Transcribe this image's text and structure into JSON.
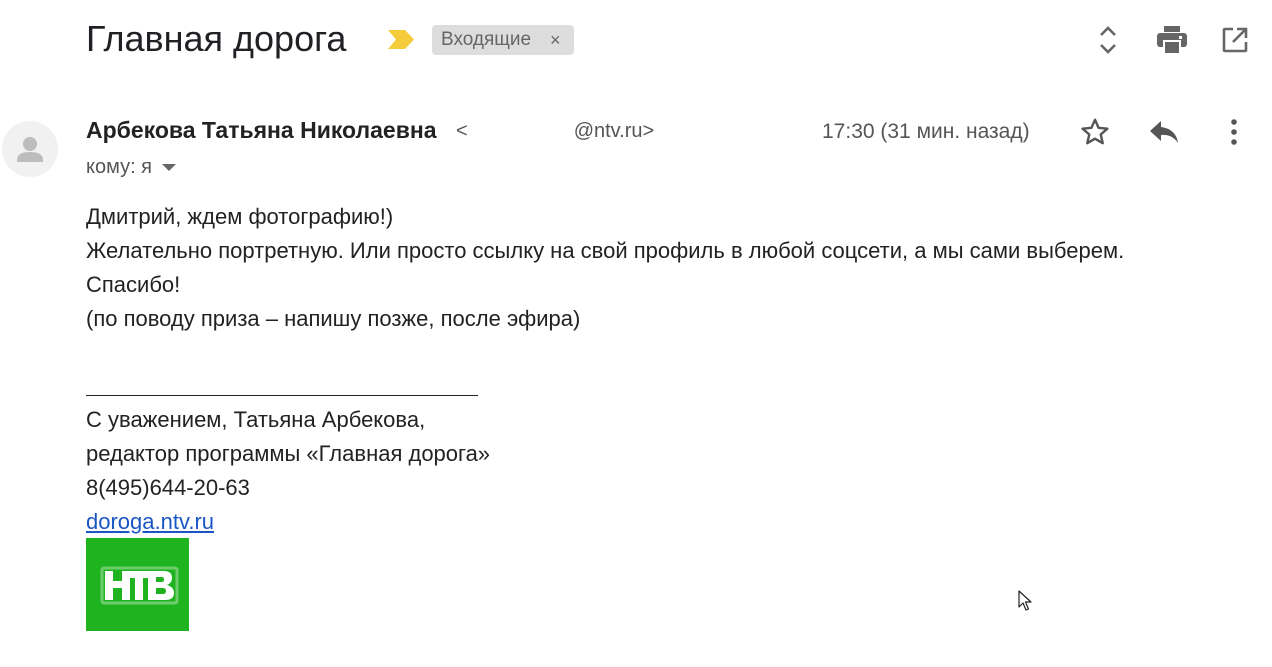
{
  "email": {
    "subject": "Главная дорога",
    "label_chip": "Входящие",
    "label_chip_close": "×",
    "sender_name": "Арбекова Татьяна Николаевна",
    "sender_email_prefix": "<",
    "sender_email_domain": "@ntv.ru>",
    "time": "17:30 (31 мин. назад)",
    "to_label": "кому: я",
    "body_lines": [
      "Дмитрий, ждем фотографию!)",
      "Желательно портретную. Или просто ссылку на свой профиль в любой соцсети, а мы сами выберем.",
      "Спасибо!",
      "(по поводу приза – напишу позже, после эфира)"
    ],
    "signature_lines": [
      "С уважением, Татьяна Арбекова,",
      "редактор программы «Главная дорога»",
      "8(495)644-20-63"
    ],
    "signature_link": "doroga.ntv.ru",
    "logo_text": "НТВ"
  },
  "icons": {
    "top": [
      "expand-collapse-icon",
      "print-icon",
      "open-in-new-window-icon"
    ],
    "header": [
      "star-icon",
      "reply-icon",
      "more-vert-icon"
    ],
    "important_marker_color": "#f4cc3c"
  },
  "colors": {
    "link": "#1a57c4",
    "chip_bg": "#dddddd",
    "logo_bg": "#1fb31f"
  }
}
